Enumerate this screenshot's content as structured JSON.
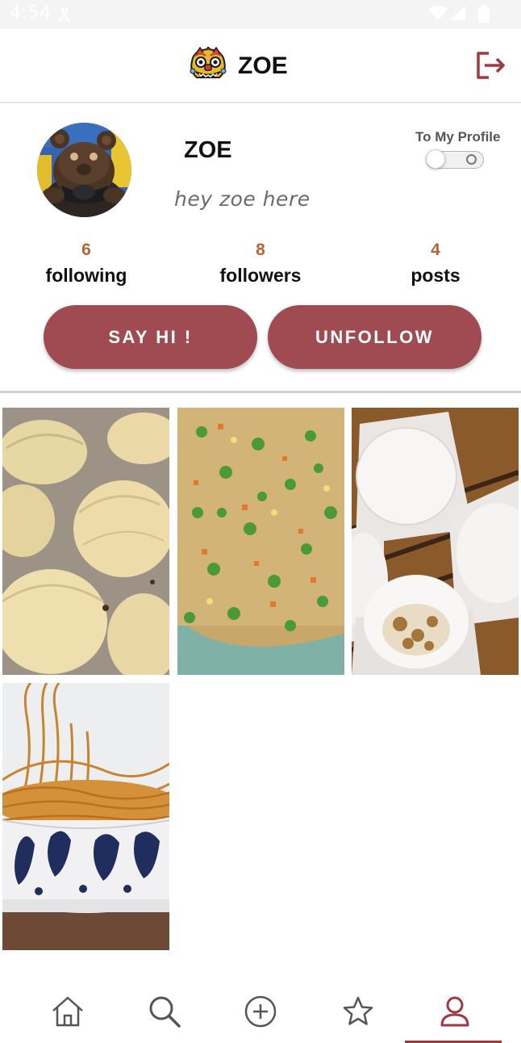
{
  "status_bar": {
    "time": "4:54"
  },
  "app_bar": {
    "title": "ZOE"
  },
  "profile": {
    "name": "ZOE",
    "bio": "hey zoe here",
    "toggle_label": "To My Profile",
    "toggle_on": false
  },
  "stats": [
    {
      "value": "6",
      "label": "following"
    },
    {
      "value": "8",
      "label": "followers"
    },
    {
      "value": "4",
      "label": "posts"
    }
  ],
  "actions": {
    "say_hi": "SAY HI !",
    "unfollow": "UNFOLLOW"
  },
  "posts": [
    {
      "name": "dumplings"
    },
    {
      "name": "fried rice"
    },
    {
      "name": "steamed buns"
    },
    {
      "name": "noodles"
    }
  ],
  "nav": {
    "items": [
      "home-icon",
      "search-icon",
      "add-circle-icon",
      "star-icon",
      "profile-icon"
    ],
    "active": "profile-icon"
  },
  "colors": {
    "accent": "#a04a52",
    "stat_number": "#b5652d",
    "nav_active": "#a0393f"
  }
}
